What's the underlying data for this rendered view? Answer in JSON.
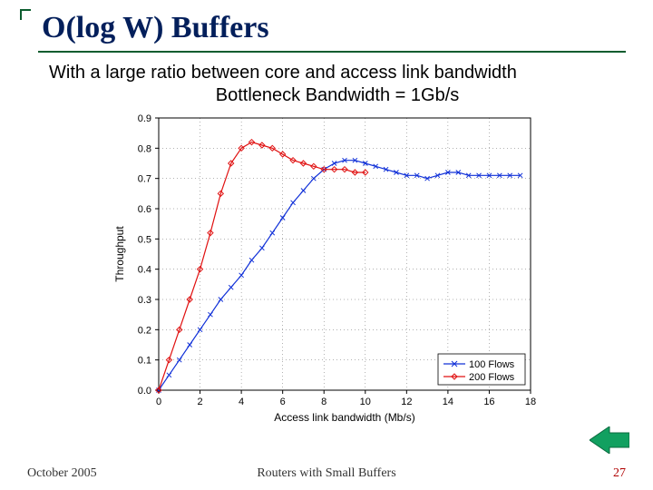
{
  "title": "O(log W) Buffers",
  "body_line1": "With a large ratio between core and access link bandwidth",
  "body_line2": "Bottleneck Bandwidth = 1Gb/s",
  "footer": {
    "date": "October 2005",
    "title": "Routers with Small Buffers",
    "page": "27"
  },
  "chart_data": {
    "type": "line",
    "xlabel": "Access link bandwidth (Mb/s)",
    "ylabel": "Throughput",
    "xlim": [
      0,
      18
    ],
    "ylim": [
      0,
      0.9
    ],
    "xticks": [
      0,
      2,
      4,
      6,
      8,
      10,
      12,
      14,
      16,
      18
    ],
    "yticks": [
      0,
      0.1,
      0.2,
      0.3,
      0.4,
      0.5,
      0.6,
      0.7,
      0.8,
      0.9
    ],
    "legend": {
      "position": "bottom-right"
    },
    "series": [
      {
        "name": "100 Flows",
        "color": "#1030d8",
        "marker": "x",
        "x": [
          0,
          0.5,
          1,
          1.5,
          2,
          2.5,
          3,
          3.5,
          4,
          4.5,
          5,
          5.5,
          6,
          6.5,
          7,
          7.5,
          8,
          8.5,
          9,
          9.5,
          10,
          10.5,
          11,
          11.5,
          12,
          12.5,
          13,
          13.5,
          14,
          14.5,
          15,
          15.5,
          16,
          16.5,
          17,
          17.5
        ],
        "y": [
          0.0,
          0.05,
          0.1,
          0.15,
          0.2,
          0.25,
          0.3,
          0.34,
          0.38,
          0.43,
          0.47,
          0.52,
          0.57,
          0.62,
          0.66,
          0.7,
          0.73,
          0.75,
          0.76,
          0.76,
          0.75,
          0.74,
          0.73,
          0.72,
          0.71,
          0.71,
          0.7,
          0.71,
          0.72,
          0.72,
          0.71,
          0.71,
          0.71,
          0.71,
          0.71,
          0.71
        ]
      },
      {
        "name": "200 Flows",
        "color": "#e01010",
        "marker": "diamond",
        "x": [
          0,
          0.5,
          1,
          1.5,
          2,
          2.5,
          3,
          3.5,
          4,
          4.5,
          5,
          5.5,
          6,
          6.5,
          7,
          7.5,
          8,
          8.5,
          9,
          9.5,
          10
        ],
        "y": [
          0.0,
          0.1,
          0.2,
          0.3,
          0.4,
          0.52,
          0.65,
          0.75,
          0.8,
          0.82,
          0.81,
          0.8,
          0.78,
          0.76,
          0.75,
          0.74,
          0.73,
          0.73,
          0.73,
          0.72,
          0.72
        ]
      }
    ]
  }
}
